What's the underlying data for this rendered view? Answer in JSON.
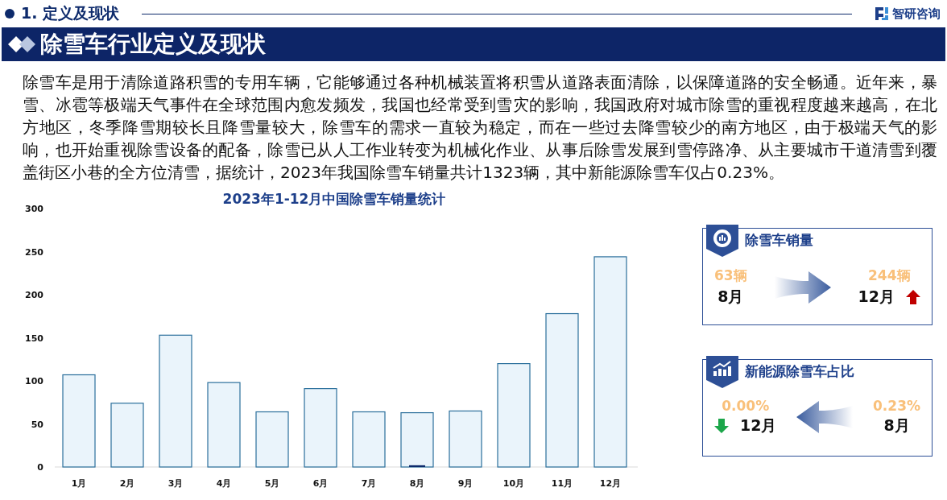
{
  "header": {
    "section": "1. 定义及现状",
    "brand": "智研咨询"
  },
  "banner": {
    "title": "除雪车行业定义及现状"
  },
  "paragraph": "除雪车是用于清除道路积雪的专用车辆，它能够通过各种机械装置将积雪从道路表面清除，以保障道路的安全畅通。近年来，暴雪、冰雹等极端天气事件在全球范围内愈发频发，我国也经常受到雪灾的影响，我国政府对城市除雪的重视程度越来越高，在北方地区，冬季降雪期较长且降雪量较大，除雪车的需求一直较为稳定，而在一些过去降雪较少的南方地区，由于极端天气的影响，也开始重视除雪设备的配备，除雪已从人工作业转变为机械化作业、从事后除雪发展到雪停路净、从主要城市干道清雪到覆盖街区小巷的全方位清雪，据统计，2023年我国除雪车销量共计1323辆，其中新能源除雪车仅占0.23%。",
  "chart": {
    "chart_data": {
      "type": "bar",
      "title": "2023年1-12月中国除雪车销量统计",
      "categories": [
        "1月",
        "2月",
        "3月",
        "4月",
        "5月",
        "6月",
        "7月",
        "8月",
        "9月",
        "10月",
        "11月",
        "12月"
      ],
      "series": [
        {
          "color": "#eaf4fb",
          "values": [
            107,
            74,
            153,
            98,
            64,
            91,
            64,
            63,
            65,
            120,
            178,
            244
          ]
        },
        {
          "color": "#0d2a6b",
          "values": [
            0,
            0,
            0,
            0,
            0,
            0,
            0,
            2,
            0,
            0,
            0,
            0
          ]
        }
      ],
      "ylim": [
        0,
        300
      ],
      "yticks": [
        0,
        50,
        100,
        150,
        200,
        250,
        300
      ]
    }
  },
  "cards": [
    {
      "kind": "sales",
      "title": "除雪车销量",
      "points_right": true,
      "left": {
        "value": "63辆",
        "month": "8月"
      },
      "right": {
        "value": "244辆",
        "month": "12月",
        "rising": true
      }
    },
    {
      "kind": "share",
      "title": "新能源除雪车占比",
      "points_right": false,
      "left": {
        "value": "0.00%",
        "month": "12月",
        "rising": false
      },
      "right": {
        "value": "0.23%",
        "month": "8月"
      }
    }
  ]
}
